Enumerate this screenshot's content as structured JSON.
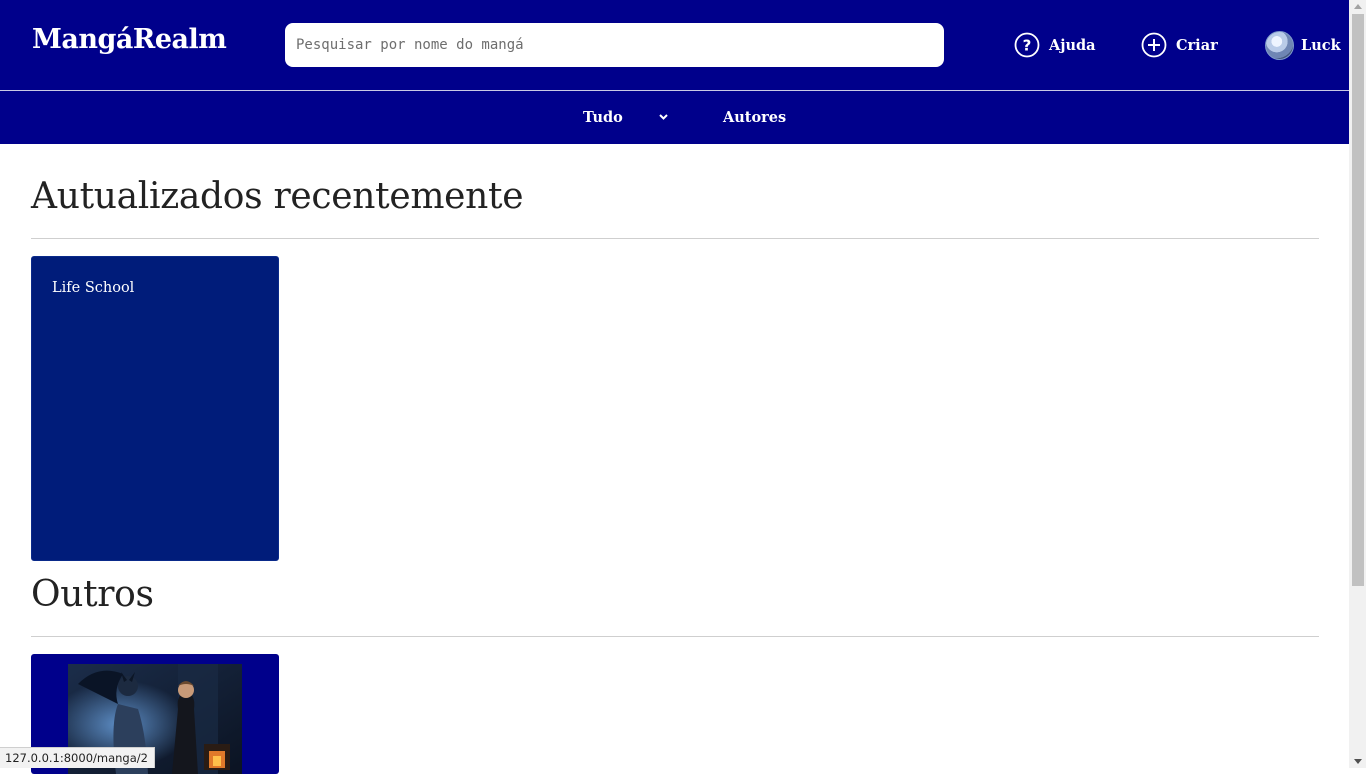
{
  "header": {
    "logo": "MangáRealm",
    "search_placeholder": "Pesquisar por nome do mangá",
    "help_label": "Ajuda",
    "create_label": "Criar",
    "user_label": "Luck",
    "help_icon": "question-circle-icon",
    "create_icon": "plus-circle-icon"
  },
  "subnav": {
    "filter_label": "Tudo",
    "filter_icon": "chevron-down-icon",
    "authors_label": "Autores"
  },
  "sections": [
    {
      "title": "Autualizados recentemente",
      "items": [
        {
          "title": "Life School"
        }
      ]
    },
    {
      "title": "Outros",
      "items": [
        {
          "title": ""
        }
      ]
    }
  ],
  "status_bar": {
    "url": "127.0.0.1:8000/manga/2"
  },
  "colors": {
    "primary": "#00008b",
    "card_bg": "#001c7a",
    "text": "#222222"
  }
}
